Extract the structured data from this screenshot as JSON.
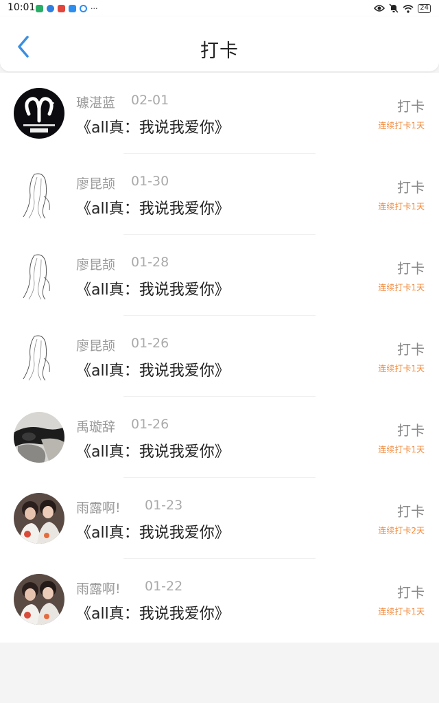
{
  "status_bar": {
    "time": "10:01",
    "battery": "24",
    "icons": [
      "wechat-icon",
      "browser-icon",
      "app-icon",
      "cloud-icon",
      "sync-icon",
      "eye-icon",
      "mute-icon",
      "wifi-icon"
    ]
  },
  "header": {
    "title": "打卡",
    "back_icon": "chevron-left-icon"
  },
  "colors": {
    "accent": "#3a8fe0",
    "streak": "#f08a3c",
    "muted": "#999999"
  },
  "entries": [
    {
      "name": "璩湛蓝",
      "date": "02-01",
      "book": "《all真：我说我爱你》",
      "action": "打卡",
      "streak": "连续打卡1天",
      "avatar": "aries-zodiac-avatar"
    },
    {
      "name": "廖昆颉",
      "date": "01-30",
      "book": "《all真：我说我爱你》",
      "action": "打卡",
      "streak": "连续打卡1天",
      "avatar": "sketch-girl-avatar"
    },
    {
      "name": "廖昆颉",
      "date": "01-28",
      "book": "《all真：我说我爱你》",
      "action": "打卡",
      "streak": "连续打卡1天",
      "avatar": "sketch-girl-avatar"
    },
    {
      "name": "廖昆颉",
      "date": "01-26",
      "book": "《all真：我说我爱你》",
      "action": "打卡",
      "streak": "连续打卡1天",
      "avatar": "sketch-girl-avatar"
    },
    {
      "name": "禹璇辞",
      "date": "01-26",
      "book": "《all真：我说我爱你》",
      "action": "打卡",
      "streak": "连续打卡1天",
      "avatar": "photo-avatar"
    },
    {
      "name": "雨露啊!",
      "date": "01-23",
      "book": "《all真：我说我爱你》",
      "action": "打卡",
      "streak": "连续打卡2天",
      "avatar": "couple-photo-avatar"
    },
    {
      "name": "雨露啊!",
      "date": "01-22",
      "book": "《all真：我说我爱你》",
      "action": "打卡",
      "streak": "连续打卡1天",
      "avatar": "couple-photo-avatar"
    }
  ]
}
